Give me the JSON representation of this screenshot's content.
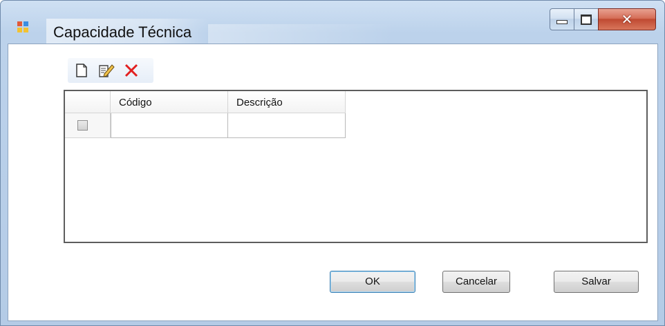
{
  "window": {
    "title": "Capacidade Técnica",
    "caption_buttons": {
      "minimize": "",
      "maximize": "",
      "close": "✕"
    }
  },
  "toolbar": {
    "items": [
      {
        "name": "new",
        "icon": "new-document-icon"
      },
      {
        "name": "edit",
        "icon": "edit-document-icon"
      },
      {
        "name": "delete",
        "icon": "delete-x-icon",
        "color": "#e21f1f"
      }
    ]
  },
  "grid": {
    "columns": [
      "Código",
      "Descrição"
    ],
    "rows": [
      {
        "selected": false,
        "codigo": "",
        "descricao": ""
      }
    ]
  },
  "buttons": {
    "ok": "OK",
    "cancel": "Cancelar",
    "save": "Salvar"
  },
  "colors": {
    "frame": "#b4cbe6",
    "close_button": "#c04a32",
    "delete_icon": "#e21f1f"
  }
}
